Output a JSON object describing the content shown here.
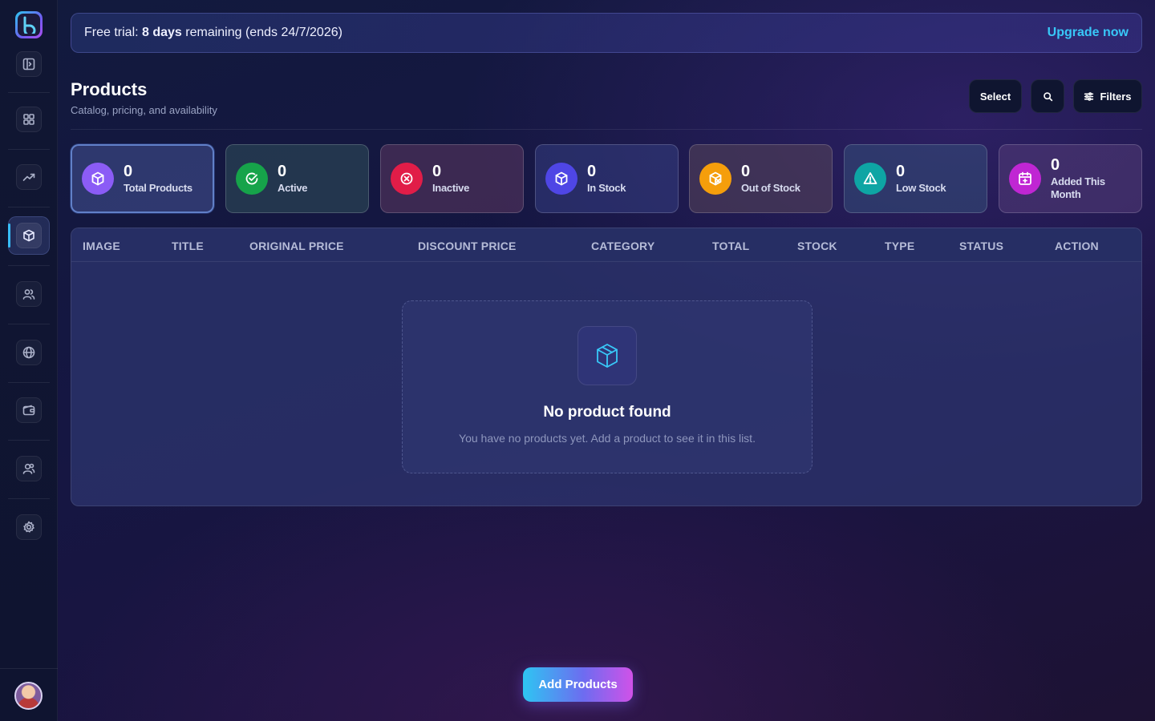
{
  "sidebar": {
    "items": [
      {
        "name": "panel-toggle-icon"
      },
      {
        "name": "dashboard-icon"
      },
      {
        "name": "analytics-icon"
      },
      {
        "name": "products-icon",
        "active": true
      },
      {
        "name": "users-icon"
      },
      {
        "name": "globe-icon"
      },
      {
        "name": "wallet-icon"
      },
      {
        "name": "team-icon"
      },
      {
        "name": "settings-icon"
      }
    ]
  },
  "banner": {
    "prefix": "Free trial: ",
    "days": "8 days",
    "suffix": " remaining (ends 24/7/2026)",
    "upgrade_label": "Upgrade now"
  },
  "header": {
    "title": "Products",
    "subtitle": "Catalog, pricing, and availability",
    "select_label": "Select",
    "filters_label": "Filters"
  },
  "stats": [
    {
      "value": "0",
      "label": "Total Products",
      "color": "#8b5cf6"
    },
    {
      "value": "0",
      "label": "Active",
      "color": "#16a34a"
    },
    {
      "value": "0",
      "label": "Inactive",
      "color": "#e11d48"
    },
    {
      "value": "0",
      "label": "In Stock",
      "color": "#4f46e5"
    },
    {
      "value": "0",
      "label": "Out of Stock",
      "color": "#f59e0b"
    },
    {
      "value": "0",
      "label": "Low Stock",
      "color": "#0ea5a4"
    },
    {
      "value": "0",
      "label": "Added This Month",
      "color": "#c026d3"
    }
  ],
  "table": {
    "columns": [
      "IMAGE",
      "TITLE",
      "ORIGINAL PRICE",
      "DISCOUNT PRICE",
      "CATEGORY",
      "TOTAL",
      "STOCK",
      "TYPE",
      "STATUS",
      "ACTION"
    ],
    "empty": {
      "title": "No product found",
      "message": "You have no products yet. Add a product to see it in this list."
    }
  },
  "add_button_label": "Add Products",
  "colors": {
    "accent": "#38c8f8",
    "background": "#151642"
  }
}
